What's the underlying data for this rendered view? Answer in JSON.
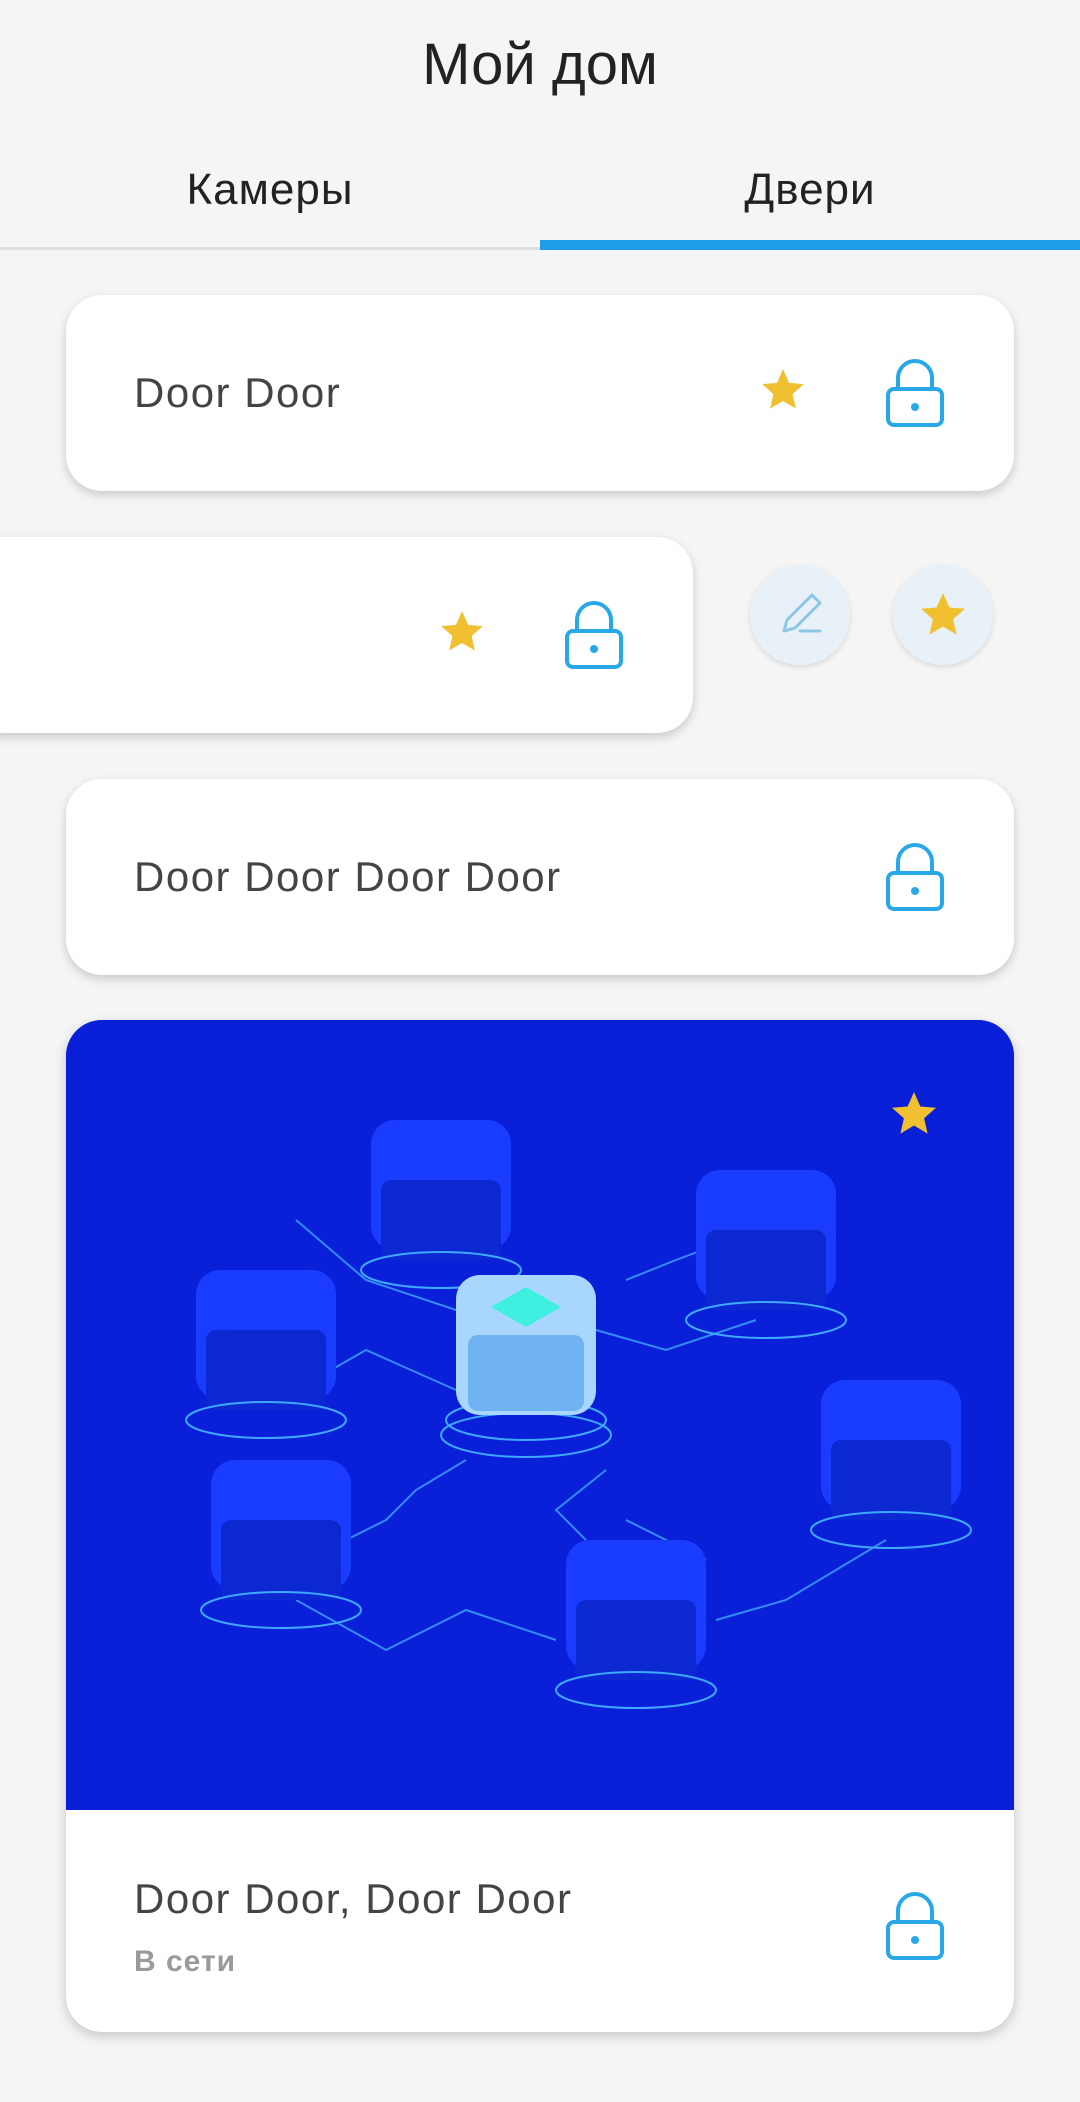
{
  "header": {
    "title": "Мой дом"
  },
  "tabs": [
    {
      "label": "Камеры",
      "active": false
    },
    {
      "label": "Двери",
      "active": true
    }
  ],
  "colors": {
    "accent": "#1e9ce8",
    "star": "#f0c030",
    "lock": "#29a8e8",
    "illustration_bg": "#0a1fd8"
  },
  "doors": [
    {
      "name": "Door Door",
      "favorite": true,
      "icon": "lock-icon"
    },
    {
      "name": "",
      "favorite": true,
      "icon": "lock-icon",
      "swiped": true,
      "swipe_actions": [
        "edit-icon",
        "star-icon"
      ]
    },
    {
      "name": "Door Door Door Door",
      "favorite": false,
      "icon": "lock-icon"
    },
    {
      "name": "Door Door, Door Door",
      "status": "В сети",
      "favorite": true,
      "icon": "lock-icon",
      "has_image": true
    }
  ]
}
